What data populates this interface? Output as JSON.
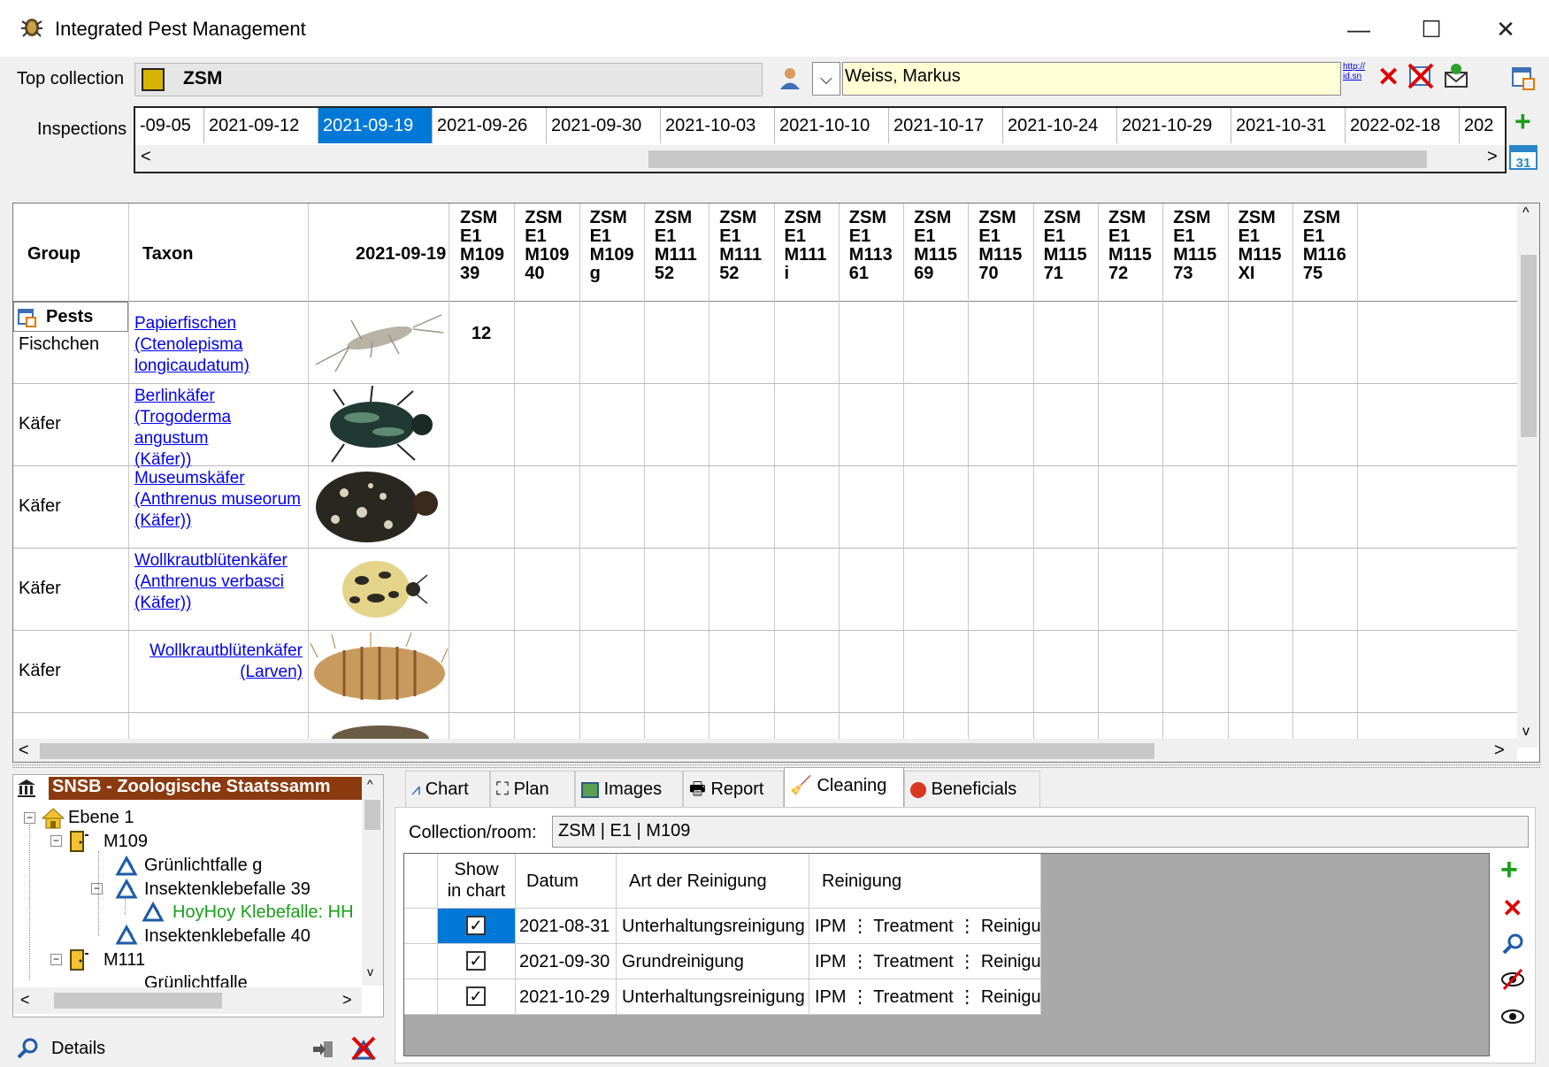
{
  "window": {
    "title": "Integrated Pest Management",
    "minimize": "—",
    "maximize": "☐",
    "close": "✕"
  },
  "top": {
    "collection_label": "Top collection",
    "collection_value": "ZSM",
    "responsible": "Weiss, Markus",
    "link_text": "http://\nid.sn"
  },
  "inspections": {
    "label": "Inspections",
    "dates": [
      "-09-05",
      "2021-09-12",
      "2021-09-19",
      "2021-09-26",
      "2021-09-30",
      "2021-10-03",
      "2021-10-10",
      "2021-10-17",
      "2021-10-24",
      "2021-10-29",
      "2021-10-31",
      "2022-02-18",
      "202"
    ],
    "selected_index": 2
  },
  "grid": {
    "col_group": "Group",
    "col_taxon": "Taxon",
    "col_date": "2021-09-19",
    "traps": [
      [
        "ZSM",
        "E1",
        "M109",
        "39"
      ],
      [
        "ZSM",
        "E1",
        "M109",
        "40"
      ],
      [
        "ZSM",
        "E1",
        "M109",
        "g"
      ],
      [
        "ZSM",
        "E1",
        "M111",
        "52"
      ],
      [
        "ZSM",
        "E1",
        "M111",
        "52"
      ],
      [
        "ZSM",
        "E1",
        "M111",
        "i"
      ],
      [
        "ZSM",
        "E1",
        "M113",
        "61"
      ],
      [
        "ZSM",
        "E1",
        "M115",
        "69"
      ],
      [
        "ZSM",
        "E1",
        "M115",
        "70"
      ],
      [
        "ZSM",
        "E1",
        "M115",
        "71"
      ],
      [
        "ZSM",
        "E1",
        "M115",
        "72"
      ],
      [
        "ZSM",
        "E1",
        "M115",
        "73"
      ],
      [
        "ZSM",
        "E1",
        "M115",
        "XI"
      ],
      [
        "ZSM",
        "E1",
        "M116",
        "75"
      ]
    ],
    "pests_label": "Pests",
    "rows": [
      {
        "group": "Fischchen",
        "taxon": [
          "Papierfischen",
          "(Ctenolepisma ",
          "longicaudatum)"
        ],
        "count": "12",
        "align": "left"
      },
      {
        "group": "Käfer",
        "taxon": [
          "Berlinkäfer",
          "(Trogoderma angustum ",
          "(Käfer))"
        ],
        "count": "",
        "align": "left"
      },
      {
        "group": "Käfer",
        "taxon": [
          "Museumskäfer",
          "(Anthrenus museorum ",
          "(Käfer))"
        ],
        "count": "",
        "align": "left"
      },
      {
        "group": "Käfer",
        "taxon": [
          "Wollkrautblütenkäfer",
          "(Anthrenus verbasci ",
          "(Käfer))"
        ],
        "count": "",
        "align": "left"
      },
      {
        "group": "Käfer",
        "taxon": [
          "Wollkrautblütenkäfer",
          "(Larven)"
        ],
        "count": "",
        "align": "right"
      }
    ]
  },
  "tree": {
    "items": [
      {
        "label": "SNSB - Zoologische Staatssamm",
        "level": 0,
        "type": "root"
      },
      {
        "label": "Ebene 1",
        "level": 1,
        "type": "floor"
      },
      {
        "label": "M109",
        "level": 2,
        "type": "room"
      },
      {
        "label": "Grünlichtfalle g",
        "level": 3,
        "type": "trap"
      },
      {
        "label": "Insektenklebefalle 39",
        "level": 3,
        "type": "trap"
      },
      {
        "label": "HoyHoy Klebefalle: HH",
        "level": 4,
        "type": "trap-green"
      },
      {
        "label": "Insektenklebefalle 40",
        "level": 3,
        "type": "trap"
      },
      {
        "label": "M111",
        "level": 2,
        "type": "room"
      },
      {
        "label": "Grünlichtfalle",
        "level": 3,
        "type": "trap"
      }
    ],
    "details_label": "Details"
  },
  "tabs": [
    "Chart",
    "Plan",
    "Images",
    "Report",
    "Cleaning",
    "Beneficials"
  ],
  "selected_tab": 4,
  "cleaning": {
    "collection_label": "Collection/room:",
    "collection_value": "ZSM | E1 | M109",
    "headers": [
      "Show\nin chart",
      "Datum",
      "Art der Reinigung",
      "Reinigung"
    ],
    "rows": [
      {
        "checked": true,
        "datum": "2021-08-31",
        "art": "Unterhaltungsreinigung",
        "reinigung": "IPM ⋮ Treatment ⋮ Reinigung"
      },
      {
        "checked": true,
        "datum": "2021-09-30",
        "art": "Grundreinigung",
        "reinigung": "IPM ⋮ Treatment ⋮ Reinigung"
      },
      {
        "checked": true,
        "datum": "2021-10-29",
        "art": "Unterhaltungsreinigung",
        "reinigung": "IPM ⋮ Treatment ⋮ Reinigung"
      }
    ]
  },
  "colors": {
    "selection": "#0078d7",
    "tree_root_bg": "#8b3a0f",
    "add_green": "#1a9e1a",
    "delete_red": "#e00000"
  }
}
